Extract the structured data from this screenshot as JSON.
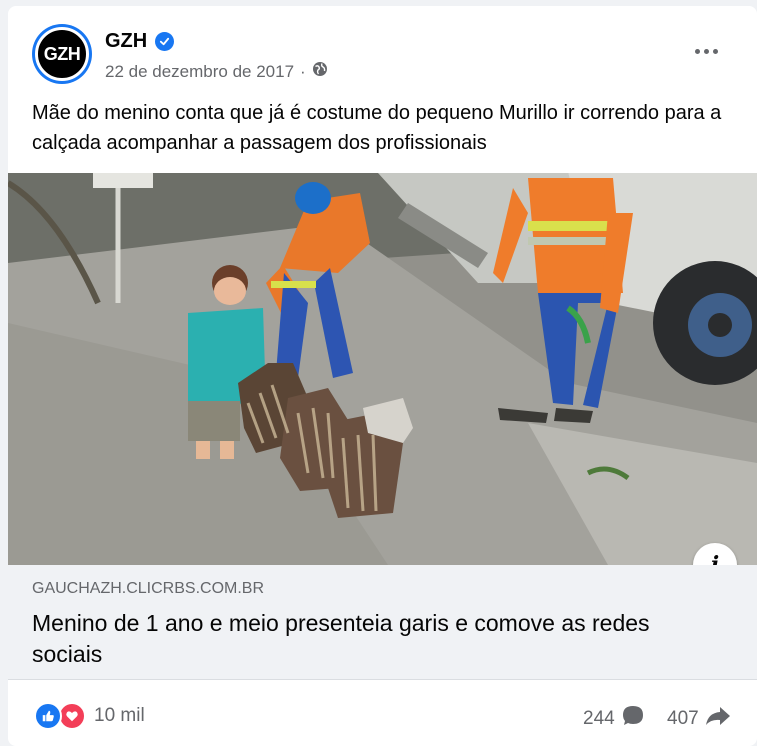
{
  "post": {
    "page_name": "GZH",
    "avatar_text": "GZH",
    "date": "22 de dezembro de 2017",
    "separator": "·",
    "message": "Mãe do menino conta que já é costume do pequeno Murillo ir correndo para a calçada acompanhar a passagem dos profissionais"
  },
  "link": {
    "domain": "GAUCHAZH.CLICRBS.COM.BR",
    "title": "Menino de 1 ano e meio presenteia garis e comove as redes sociais",
    "info_label": "i"
  },
  "footer": {
    "reactions_count": "10 mil",
    "comments_count": "244",
    "shares_count": "407"
  },
  "colors": {
    "accent": "#1877f2",
    "love": "#f33e58",
    "secondary_text": "#65676b"
  },
  "icons": {
    "verified": "verified-badge-icon",
    "privacy": "globe-icon",
    "more": "more-horizontal-icon",
    "like": "like-icon",
    "love": "love-icon",
    "comment": "comment-icon",
    "share": "share-icon",
    "info": "info-icon"
  }
}
